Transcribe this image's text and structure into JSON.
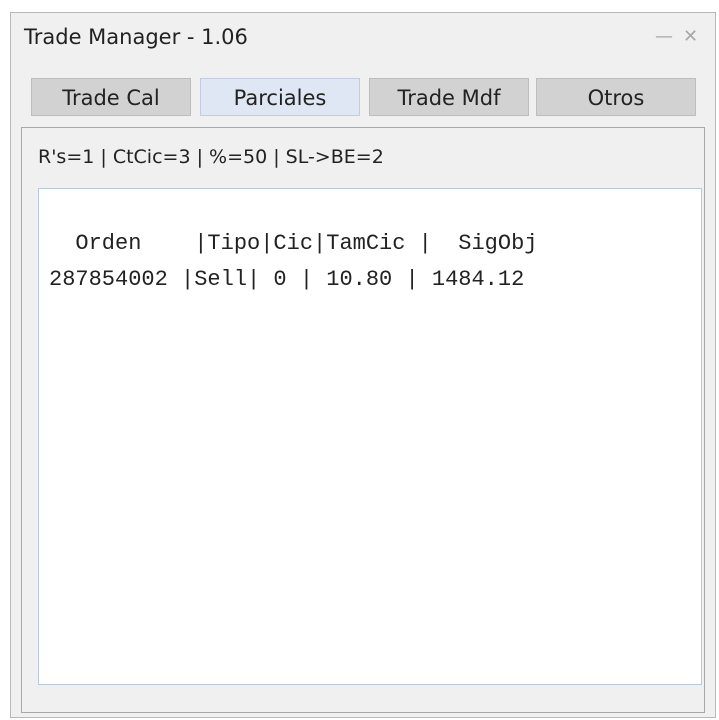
{
  "window": {
    "title": "Trade Manager - 1.06",
    "minimize_glyph": "—",
    "close_glyph": "✕"
  },
  "tabs": [
    {
      "label": "Trade Cal",
      "active": false
    },
    {
      "label": "Parciales",
      "active": true
    },
    {
      "label": "Trade Mdf",
      "active": false
    },
    {
      "label": "Otros",
      "active": false
    }
  ],
  "params_line": "R's=1  |  CtCic=3  |  %=50  |  SL->BE=2",
  "list": {
    "header": "  Orden    |Tipo|Cic|TamCic |  SigObj",
    "rows": [
      "287854002 |Sell| 0 | 10.80 | 1484.12"
    ]
  },
  "colors": {
    "tab_inactive": "#d2d2d2",
    "tab_active": "#dfe6f4",
    "window_bg": "#f0f0f0"
  }
}
